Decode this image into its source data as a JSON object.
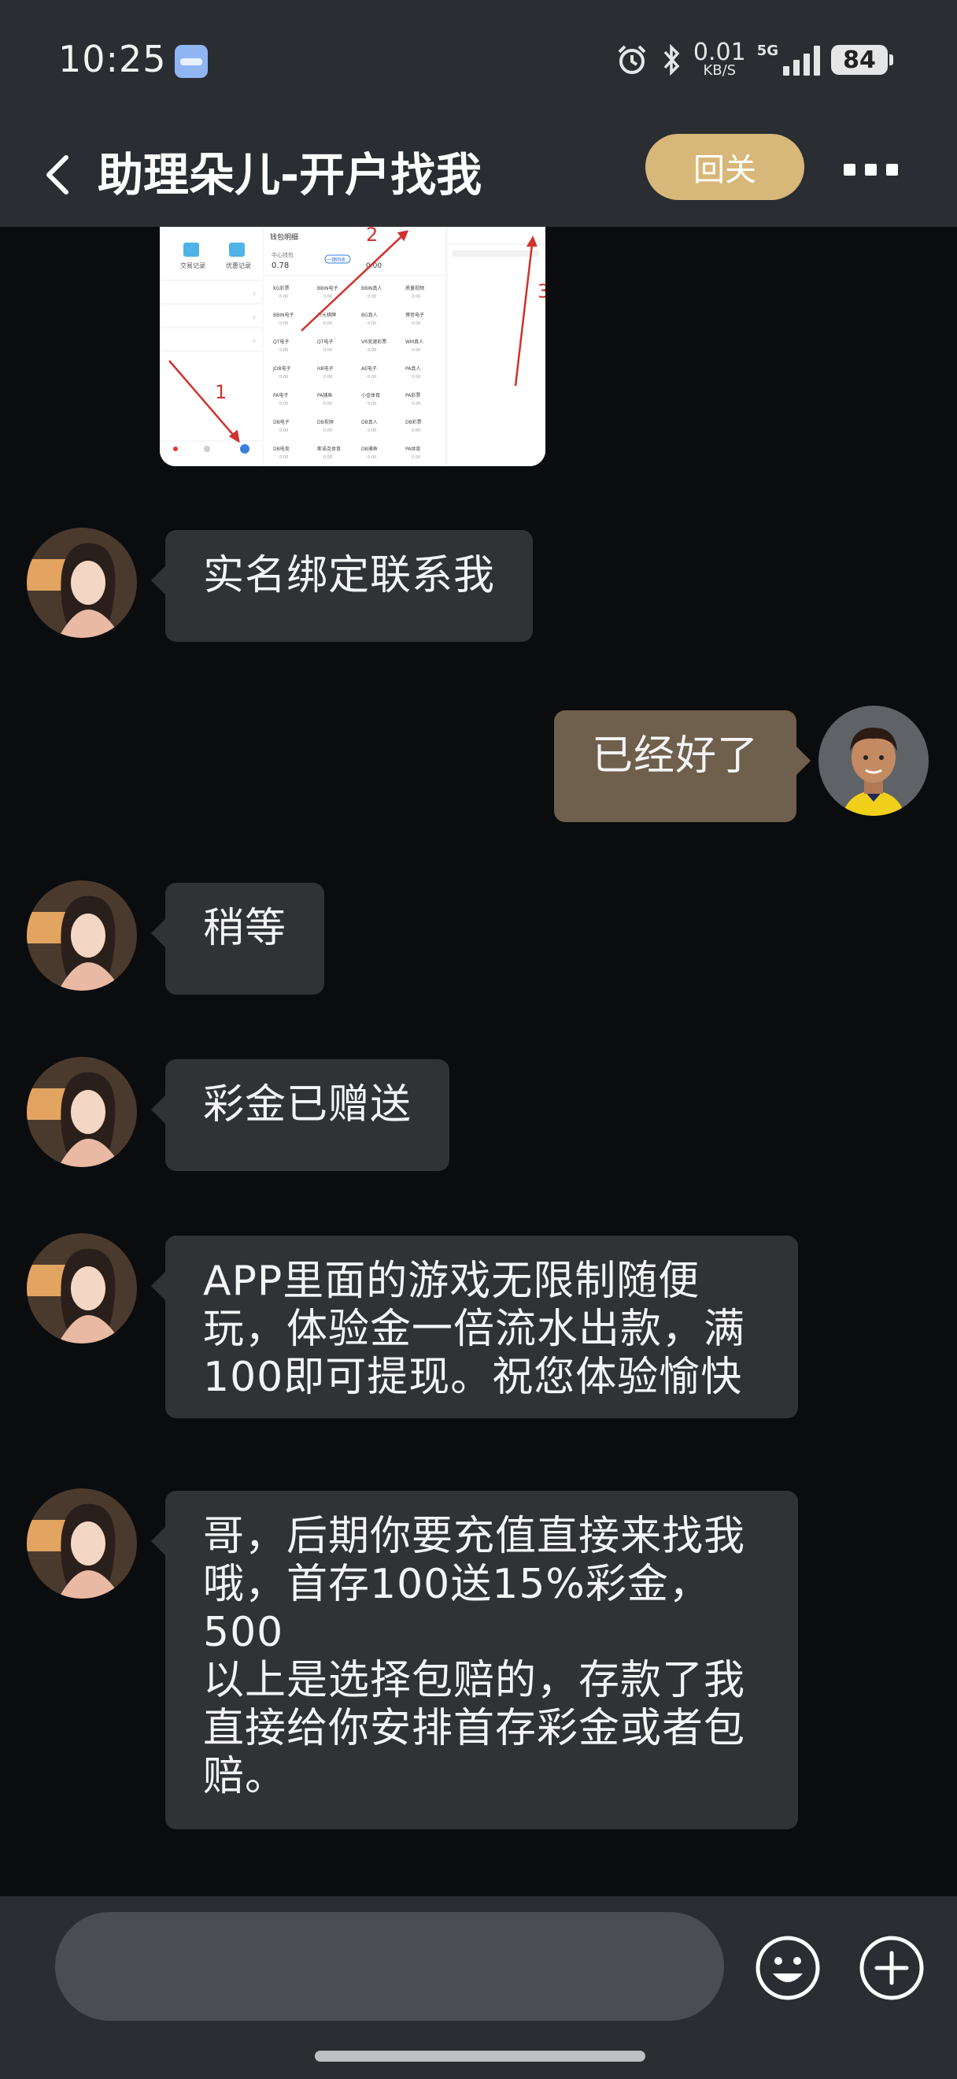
{
  "status_bar": {
    "time": "10:25",
    "net_speed": "0.01",
    "net_unit": "KB/S",
    "network": "5G",
    "battery": "84"
  },
  "header": {
    "title": "助理朵儿-开户找我",
    "follow_label": "回关"
  },
  "messages": [
    {
      "side": "left",
      "text": "实名绑定联系我"
    },
    {
      "side": "right",
      "text": "已经好了"
    },
    {
      "side": "left",
      "text": "稍等"
    },
    {
      "side": "left",
      "text": "彩金已赠送"
    },
    {
      "side": "left",
      "text": "APP里面的游戏无限制随便\n玩，体验金一倍流水出款，满\n100即可提现。祝您体验愉快"
    },
    {
      "side": "left",
      "text": "哥，后期你要充值直接来找我\n哦，首存100送15%彩金，500\n以上是选择包赔的，存款了我\n直接给你安排首存彩金或者包\n赔。"
    }
  ],
  "screenshot_image": {
    "left_icons": [
      "交易记录",
      "优惠记录"
    ],
    "wallet_title": "钱包明细",
    "center_wallet_label": "中心钱包",
    "center_wallet_value": "0.78",
    "collect_button": "一键回收",
    "other_value": "0.00",
    "games": [
      "KG彩票",
      "BBIN电子",
      "BBIN真人",
      "质量视频",
      "BBIN电子",
      "开元棋牌",
      "BG真人",
      "博音电子",
      "QT电子",
      "QT电子",
      "VR竞速彩票",
      "WM真人",
      "JDB电子",
      "HB电子",
      "AE电子",
      "PA真人",
      "PA电子",
      "PA捕鱼",
      "小金体育",
      "PA彩票",
      "DB电子",
      "DB视频",
      "DB真人",
      "DB彩票",
      "DB电竞",
      "斯诺克体育",
      "DB捕鱼",
      "PA体育"
    ],
    "game_value": "0.00",
    "annotations": [
      "1",
      "2",
      "3"
    ]
  },
  "colors": {
    "bar_bg": "#2a2d31",
    "chat_bg": "#0b0c0e",
    "bubble_left": "#303236",
    "bubble_right": "#6f5f4d",
    "follow_btn": "#d8b77a",
    "arrow_red": "#d0322e"
  },
  "input": {
    "placeholder": ""
  }
}
